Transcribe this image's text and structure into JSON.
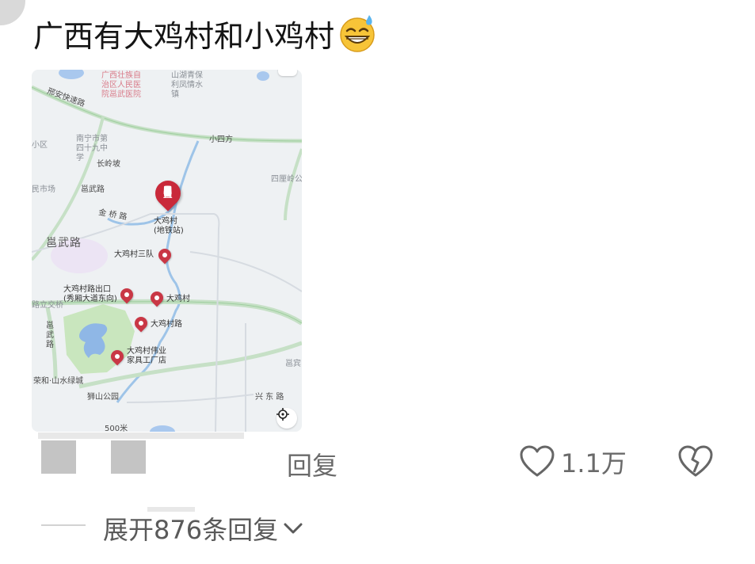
{
  "comment": {
    "text": "广西有大鸡村和小鸡村",
    "emoji": "grinning-sweat-emoji"
  },
  "map": {
    "labels": {
      "expressway": "邢安快速路",
      "hospital": "广西壮族自治区人民医院邕武医院",
      "town": "山湖青保利凤情水镇",
      "school": "南宁市第四十九中学",
      "xiaosifang": "小四方",
      "changlingpo": "长岭坡",
      "yongwu_small": "邕武路",
      "market": "民市场",
      "jinqiao": "金 桥 路",
      "sililing": "四厘岭公",
      "yongwu_big": "邕武路",
      "xiaoqu": "小区",
      "station": "大鸡村(地铁站)",
      "team3": "大鸡村三队",
      "exit": "大鸡村路出口(秀厢大道东向)",
      "village": "大鸡村",
      "road": "大鸡村路",
      "furniture": "大鸡村伟业家具工厂店",
      "lizheng": "路立交桥",
      "yongwu_v": "邕武路",
      "rongheshan": "荣和·山水绿城",
      "shishan": "狮山公园",
      "xingdong": "兴 东 路",
      "yongbin": "邕宾",
      "scale": "500米"
    }
  },
  "actions": {
    "reply_label": "回复",
    "like_count": "1.1万",
    "expand_label": "展开876条回复"
  }
}
